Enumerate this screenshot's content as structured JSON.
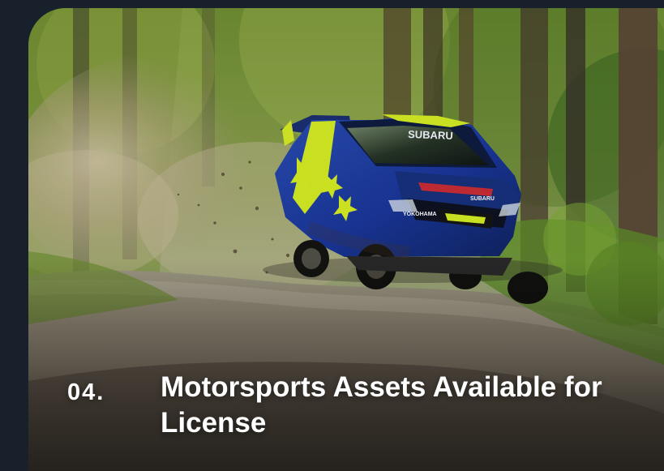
{
  "card": {
    "number": "04.",
    "title": "Motorsports Assets Available for License"
  },
  "image": {
    "subject": "blue and yellow rally car jumping on a forest dirt road",
    "car_decals": {
      "brand": "SUBARU",
      "tire_brand": "YOKOHAMA"
    }
  },
  "colors": {
    "frame_background": "#18212b",
    "text": "#ffffff",
    "car_blue": "#1f3fa0",
    "car_yellow": "#d7ef24",
    "forest_green": "#6d8f2e"
  }
}
